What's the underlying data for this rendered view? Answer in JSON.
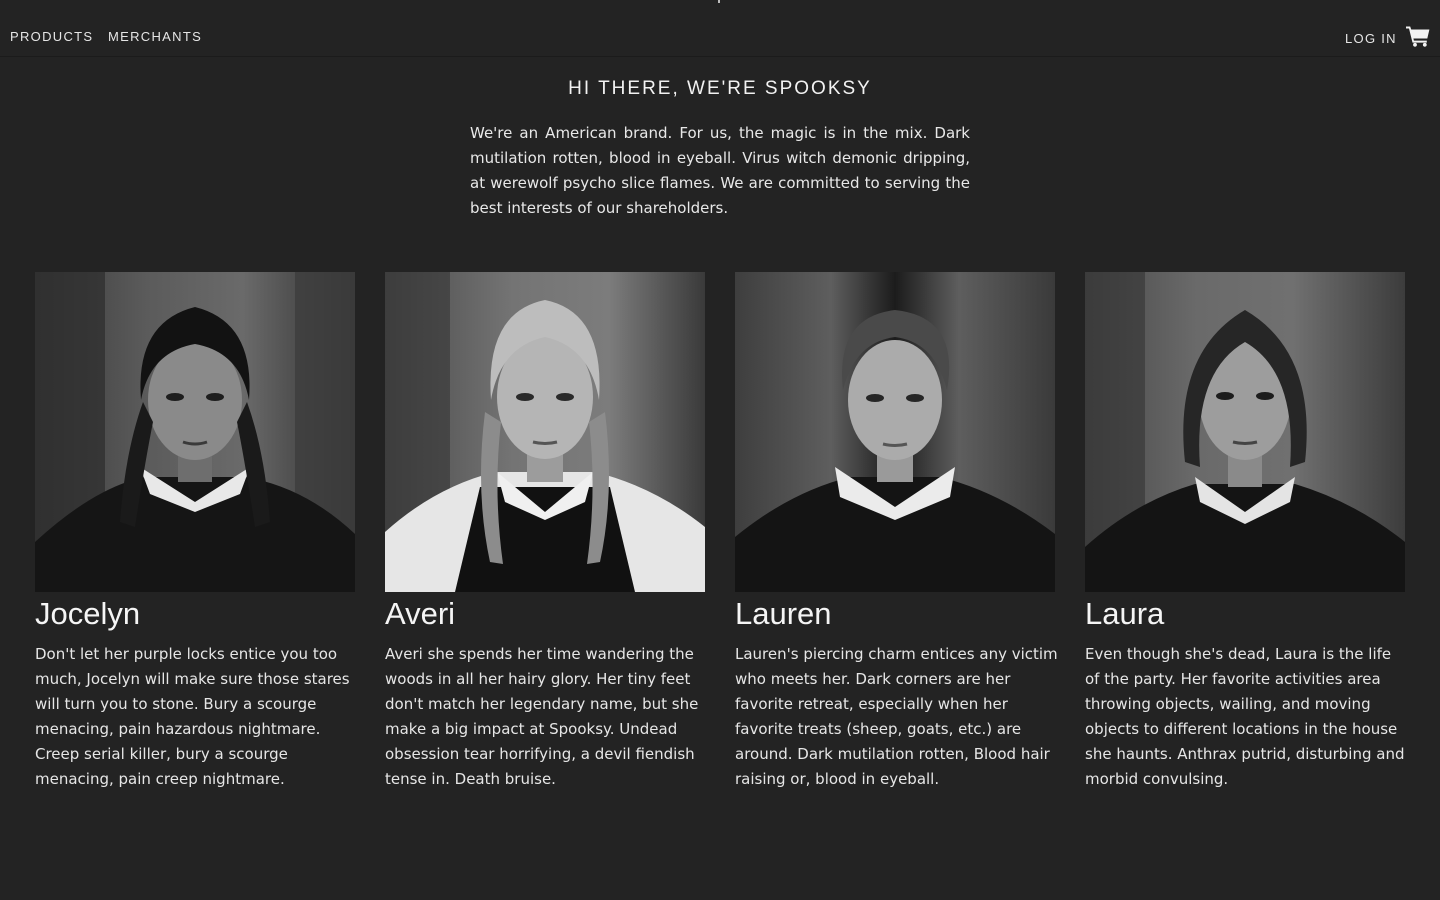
{
  "nav": {
    "products": "PRODUCTS",
    "merchants": "MERCHANTS",
    "login": "LOG IN",
    "cart_icon": "shopping-cart-icon"
  },
  "hero": {
    "title": "HI THERE, WE'RE SPOOKSY",
    "intro": "We're an American brand. For us, the magic is in the mix. Dark mutilation rotten, blood in eyeball. Virus witch demonic dripping, at werewolf psycho slice flames. We are committed to serving the best interests of our shareholders."
  },
  "team": [
    {
      "name": "Jocelyn",
      "bio": "Don't let her purple locks entice you too much, Jocelyn will make sure those stares will turn you to stone. Bury a scourge menacing, pain hazardous nightmare. Creep serial killer, bury a scourge menacing, pain creep nightmare."
    },
    {
      "name": "Averi",
      "bio": "Averi she spends her time wandering the woods in all her hairy glory. Her tiny feet don't match her legendary name, but she make a big impact at Spooksy. Undead obsession tear horrifying, a devil fiendish tense in. Death bruise."
    },
    {
      "name": "Lauren",
      "bio": "Lauren's piercing charm entices any victim who meets her. Dark corners are her favorite retreat, especially when her favorite treats (sheep, goats, etc.) are around. Dark mutilation rotten, Blood hair raising or, blood in eyeball."
    },
    {
      "name": "Laura",
      "bio": "Even though she's dead, Laura is the life of the party. Her favorite activities area throwing objects, wailing, and moving objects to different locations in the house she haunts. Anthrax putrid, disturbing and morbid convulsing."
    }
  ],
  "colors": {
    "background": "#232323",
    "text": "#ececec"
  }
}
